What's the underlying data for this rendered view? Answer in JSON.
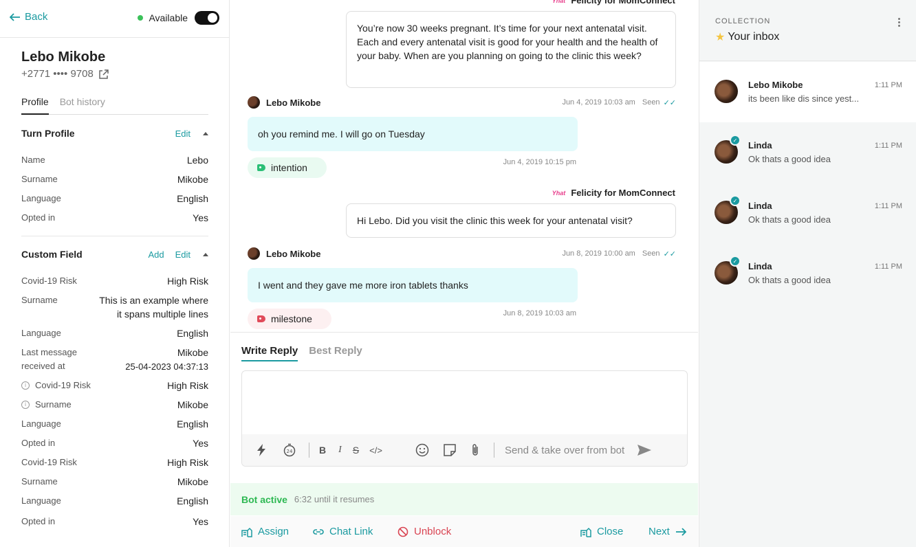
{
  "header": {
    "back_label": "Back",
    "status_label": "Available"
  },
  "contact": {
    "name": "Lebo Mikobe",
    "phone": "+2771 •••• 9708"
  },
  "profile_tabs": [
    "Profile",
    "Bot history"
  ],
  "turn_profile": {
    "title": "Turn Profile",
    "edit_label": "Edit",
    "fields": [
      {
        "label": "Name",
        "value": "Lebo"
      },
      {
        "label": "Surname",
        "value": "Mikobe"
      },
      {
        "label": "Language",
        "value": "English"
      },
      {
        "label": "Opted in",
        "value": "Yes"
      }
    ]
  },
  "custom_field": {
    "title": "Custom Field",
    "add_label": "Add",
    "edit_label": "Edit",
    "fields": [
      {
        "label": "Covid-19 Risk",
        "value": "High Risk"
      },
      {
        "label": "Surname",
        "value": "This is an example where it spans multiple lines"
      },
      {
        "label": "Language",
        "value": "English"
      },
      {
        "label": "Last message received at",
        "value": "Mikobe 25-04-2023 04:37:13"
      },
      {
        "label": "Covid-19 Risk",
        "value": "High Risk"
      },
      {
        "label": "Surname",
        "value": "Mikobe"
      },
      {
        "label": "Language",
        "value": "English"
      },
      {
        "label": "Opted in",
        "value": "Yes"
      },
      {
        "label": "Covid-19 Risk",
        "value": "High Risk"
      },
      {
        "label": "Surname",
        "value": "Mikobe"
      },
      {
        "label": "Language",
        "value": "English"
      },
      {
        "label": "Opted in",
        "value": "Yes"
      }
    ],
    "last_msg_label_lines": [
      "Last message",
      "received at"
    ],
    "last_msg_value_lines": [
      "Mikobe",
      "25-04-2023 04:37:13"
    ],
    "surname_value_lines": [
      "This is an example where",
      "it spans multiple lines"
    ]
  },
  "conversation": {
    "bot_name": "Felicity for MomConnect",
    "bot_logo_text": "Yhat",
    "contact_name": "Lebo Mikobe",
    "seen_label": "Seen",
    "messages": [
      {
        "text": "You’re now 30 weeks pregnant. It’s time for your next antenatal visit. Each and every antenatal visit is good for your health and the health of your baby. When are you planning on going to the clinic this week?"
      },
      {
        "timestamp": "Jun 4, 2019 10:03 am",
        "text": "oh you remind me. I will go on Tuesday",
        "tag": "intention",
        "tag_time": "Jun 4, 2019 10:15 pm"
      },
      {
        "text": "Hi Lebo. Did you visit the clinic this week for your antenatal visit?"
      },
      {
        "timestamp": "Jun 8, 2019 10:00 am",
        "text": "I went and they gave me more iron tablets thanks",
        "tag": "milestone",
        "tag_time": "Jun 8, 2019 10:03 am"
      }
    ]
  },
  "reply": {
    "tabs": [
      "Write Reply",
      "Best Reply"
    ],
    "toolbar": {
      "bold": "B",
      "italic": "I",
      "strike": "S",
      "code": "</>",
      "timer_text": "24"
    },
    "send_label": "Send & take over from bot"
  },
  "bot_status": {
    "active_label": "Bot active",
    "until_label": "6:32 until it resumes"
  },
  "actions": {
    "assign": "Assign",
    "chat_link": "Chat Link",
    "unblock": "Unblock",
    "close": "Close",
    "next": "Next"
  },
  "collection": {
    "label": "COLLECTION",
    "name": "Your inbox",
    "conversations": [
      {
        "name": "Lebo Mikobe",
        "time": "1:11 PM",
        "preview": "its been like dis since yest..."
      },
      {
        "name": "Linda",
        "time": "1:11 PM",
        "preview": "Ok thats a good idea"
      },
      {
        "name": "Linda",
        "time": "1:11 PM",
        "preview": "Ok thats a good idea"
      },
      {
        "name": "Linda",
        "time": "1:11 PM",
        "preview": "Ok thats a good idea"
      }
    ]
  }
}
